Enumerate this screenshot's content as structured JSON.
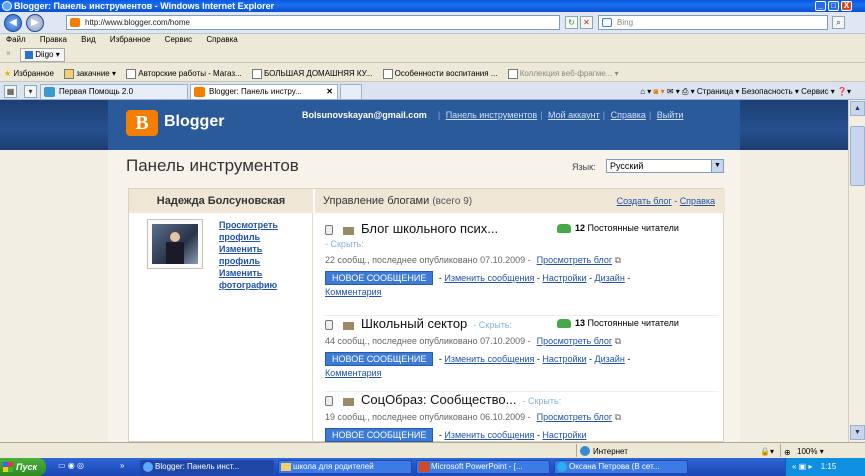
{
  "window": {
    "title": "Blogger: Панель инструментов - Windows Internet Explorer",
    "min": "_",
    "max": "□",
    "close": "X"
  },
  "address": {
    "url": "http://www.blogger.com/home",
    "search": "Bing"
  },
  "menu": [
    "Файл",
    "Правка",
    "Вид",
    "Избранное",
    "Сервис",
    "Справка"
  ],
  "links_bar": {
    "item": "Diigo"
  },
  "favorites_bar": {
    "label": "Избранное",
    "items": [
      "закачние",
      "Авторские работы - Магаз...",
      "БОЛЬШАЯ ДОМАШНЯЯ КУ...",
      "Особенности воспитания ...",
      "Коллекция веб-фрагме..."
    ]
  },
  "tabs": [
    {
      "label": "Первая Помощь 2.0"
    },
    {
      "label": "Blogger: Панель инстру..."
    }
  ],
  "commandbar": {
    "page": "Страница ▾",
    "safety": "Безопасность ▾",
    "tools": "Сервис ▾"
  },
  "blogger": {
    "logo_letter": "B",
    "logo_text": "Blogger",
    "email": "Bolsunovskayan@gmail.com",
    "links": [
      "Панель инструментов",
      "Мой аккаунт",
      "Справка",
      "Выйти"
    ]
  },
  "dashboard": {
    "title": "Панель инструментов",
    "language_label": "Язык:",
    "language_value": "Русский",
    "profile_name": "Надежда Болсуновская",
    "profile_links": [
      "Просмотреть профиль",
      "Изменить профиль",
      "Изменить фотографию"
    ],
    "manage_label": "Управление блогами",
    "manage_count": "(всего 9)",
    "create_blog": "Создать блог",
    "help": "Справка"
  },
  "blogs": [
    {
      "name": "Блог школьного псих...",
      "hide": "- Скрыть:",
      "readers": "12",
      "readers_label": "Постоянные читатели",
      "meta": "22 сообщ., последнее опубликовано 07.10.2009 -",
      "view": "Просмотреть блог",
      "new_post": "НОВОЕ СООБЩЕНИЕ",
      "edit": "Изменить сообщения",
      "settings": "Настройки",
      "design": "Дизайн",
      "comments": "Комментария"
    },
    {
      "name": "Школьный сектор",
      "hide": "- Скрыть:",
      "readers": "13",
      "readers_label": "Постоянные читатели",
      "meta": "44 сообщ., последнее опубликовано 07.10.2009 -",
      "view": "Просмотреть блог",
      "new_post": "НОВОЕ СООБЩЕНИЕ",
      "edit": "Изменить сообщения",
      "settings": "Настройки",
      "design": "Дизайн",
      "comments": "Комментария"
    },
    {
      "name": "СоцОбраз: Сообщество...",
      "hide": "- Скрыть:",
      "meta": "19 сообщ., последнее опубликовано 06.10.2009 -",
      "view": "Просмотреть блог",
      "new_post": "НОВОЕ СООБЩЕНИЕ",
      "edit": "Изменить сообщения",
      "settings": "Настройки"
    }
  ],
  "status": {
    "zone": "Интернет",
    "zoom": "100%"
  },
  "taskbar": {
    "start": "Пуск",
    "tasks": [
      "Blogger: Панель инст...",
      "школа для родителей",
      "Microsoft PowerPoint - [...",
      "Оксана Петрова (В сет..."
    ],
    "clock": "1:15"
  }
}
